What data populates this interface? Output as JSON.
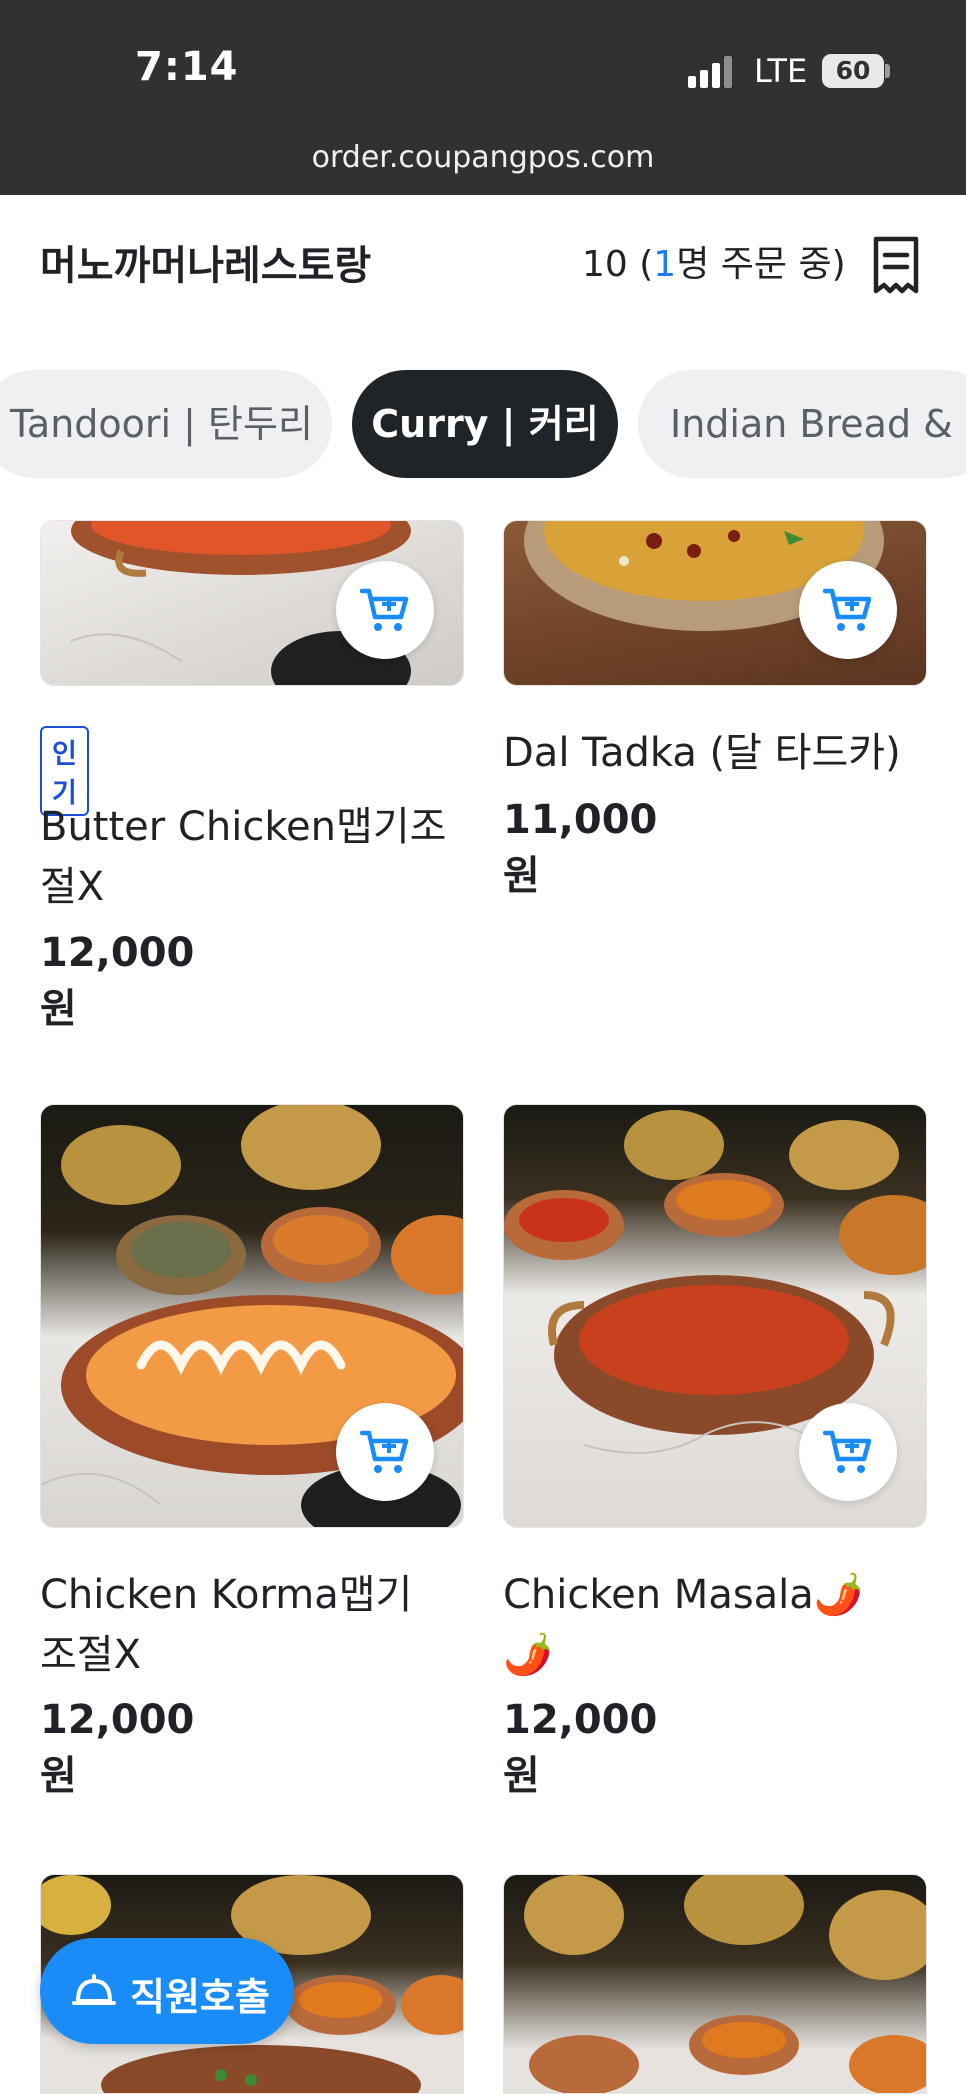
{
  "status_bar": {
    "time": "7:14",
    "network": "LTE",
    "battery": "60",
    "url": "order.coupangpos.com"
  },
  "header": {
    "store_name": "머노까머나레스토랑",
    "table_number": "10 (",
    "ordering_count": "1",
    "ordering_suffix": "명 주문 중)",
    "receipt_icon": "receipt-icon"
  },
  "tabs": [
    {
      "label": "Tandoori | 탄두리",
      "active": false
    },
    {
      "label": "Curry | 커리",
      "active": true
    },
    {
      "label": "Indian Bread & B",
      "active": false
    }
  ],
  "menu_items": [
    {
      "badge": "인기",
      "name": "Butter Chicken맵기조절X",
      "name_line1": "Butter Chicken맵기조",
      "name_line2": "절X",
      "price": "12,000원"
    },
    {
      "badge": "",
      "name": "Dal Tadka (달 타드카)",
      "price": "11,000원"
    },
    {
      "badge": "",
      "name": "Chicken Korma맵기조절X",
      "name_line1": "Chicken Korma맵기",
      "name_line2": "조절X",
      "price": "12,000원"
    },
    {
      "badge": "",
      "name": "Chicken Masala🌶️🌶️",
      "name_line1": "Chicken Masala🌶️",
      "name_line2": "🌶️",
      "price": "12,000원"
    }
  ],
  "staff_call": {
    "label": "직원호출",
    "icon": "bell-icon"
  },
  "colors": {
    "accent": "#1a8cf7",
    "dark": "#1f2429",
    "status_bar": "#2f3133",
    "badge": "#1a4fd6"
  }
}
